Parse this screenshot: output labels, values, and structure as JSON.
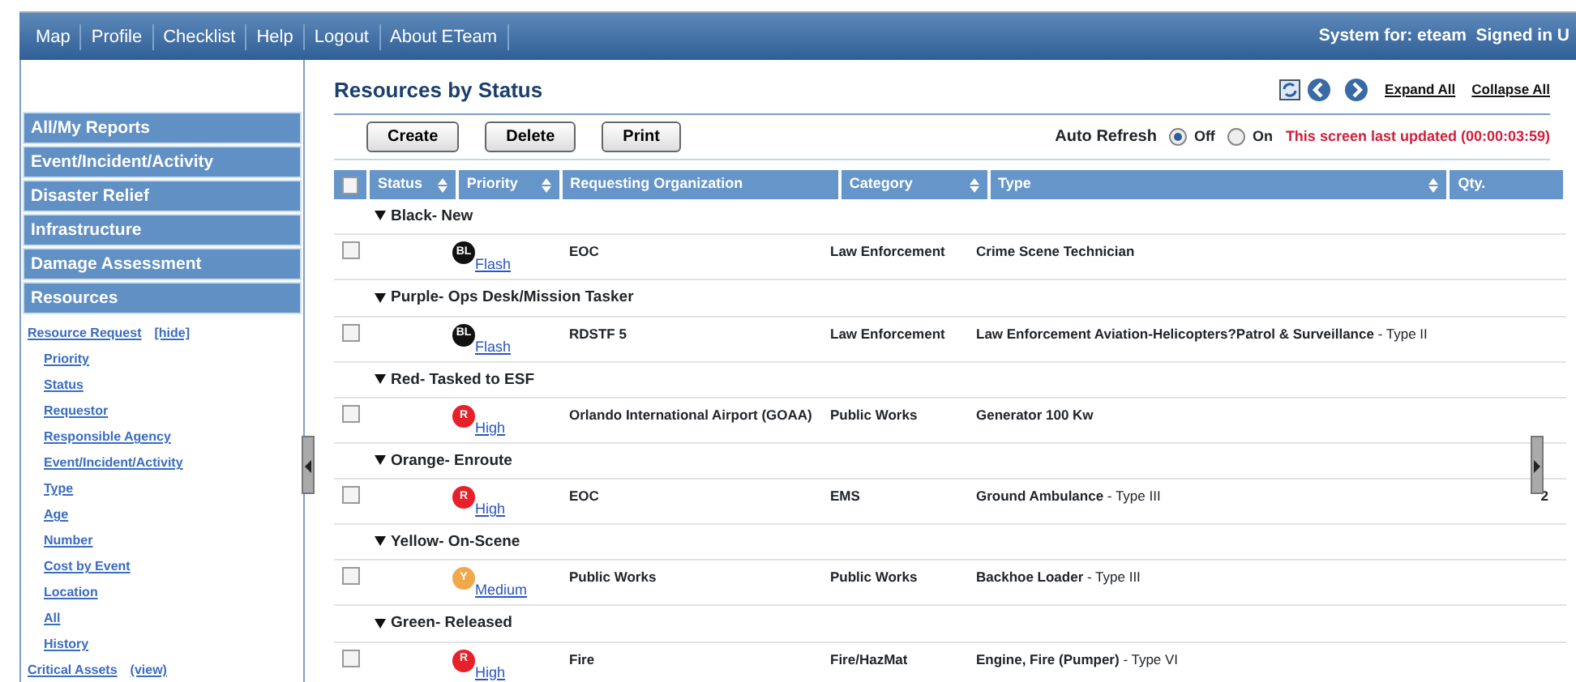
{
  "top_menu": [
    "Map",
    "Profile",
    "Checklist",
    "Help",
    "Logout",
    "About ETeam"
  ],
  "system_text": "System for: eteam  Signed in U",
  "sidebar": {
    "sections": [
      {
        "label": "All/My Reports"
      },
      {
        "label": "Event/Incident/Activity"
      },
      {
        "label": "Disaster Relief"
      },
      {
        "label": "Infrastructure"
      },
      {
        "label": "Damage Assessment"
      },
      {
        "label": "Resources"
      }
    ],
    "links": [
      {
        "label": "Resource Request",
        "action": "[hide]",
        "children": [
          {
            "label": "Priority"
          },
          {
            "label": "Status"
          },
          {
            "label": "Requestor"
          },
          {
            "label": "Responsible Agency"
          },
          {
            "label": "Event/Incident/Activity"
          },
          {
            "label": "Type"
          },
          {
            "label": "Age"
          },
          {
            "label": "Number"
          },
          {
            "label": "Cost by Event"
          },
          {
            "label": "Location"
          },
          {
            "label": "All"
          },
          {
            "label": "History"
          }
        ]
      },
      {
        "label": "Critical Assets",
        "action": "(view)"
      }
    ]
  },
  "page_title": "Resources by Status",
  "header_links": [
    "Expand All",
    "Collapse All"
  ],
  "buttons": [
    "Create",
    "Delete",
    "Print"
  ],
  "auto_refresh": {
    "label": "Auto Refresh",
    "options": [
      {
        "label": "Off",
        "selected": true
      },
      {
        "label": "On",
        "selected": false
      }
    ],
    "status": "This screen last updated (00:00:03:59)"
  },
  "table": {
    "select_all_checked": false,
    "columns": [
      {
        "label": "Status",
        "sortable": true
      },
      {
        "label": "Priority",
        "sortable": true
      },
      {
        "label": "Requesting Organization",
        "sortable": false
      },
      {
        "label": "Category",
        "sortable": true
      },
      {
        "label": "Type",
        "sortable": true
      },
      {
        "label": "Qty.",
        "sortable": false
      }
    ],
    "groups": [
      {
        "label": "Black- New",
        "rows": [
          {
            "checked": false,
            "badge": "BL",
            "color": "#111111",
            "priority": "Flash",
            "organization": "EOC",
            "category": "Law Enforcement",
            "type": "**Crime Scene Technician**",
            "qty": ""
          }
        ]
      },
      {
        "label": "Purple- Ops Desk/Mission Tasker",
        "rows": [
          {
            "checked": false,
            "badge": "BL",
            "color": "#111111",
            "priority": "Flash",
            "organization": "RDSTF 5",
            "category": "Law Enforcement",
            "type": "**Law Enforcement Aviation-Helicopters?Patrol & Surveillance** - Type II",
            "qty": ""
          }
        ]
      },
      {
        "label": "Red- Tasked to ESF",
        "rows": [
          {
            "checked": false,
            "badge": "R",
            "color": "#e8202a",
            "priority": "High",
            "organization": "Orlando International Airport (GOAA)",
            "category": "Public Works",
            "type": "**Generator 100 Kw**",
            "qty": ""
          }
        ]
      },
      {
        "label": "Orange- Enroute",
        "rows": [
          {
            "checked": false,
            "badge": "R",
            "color": "#e8202a",
            "priority": "High",
            "organization": "EOC",
            "category": "EMS",
            "type": "**Ground Ambulance** - Type III",
            "qty": "2"
          }
        ]
      },
      {
        "label": "Yellow- On-Scene",
        "rows": [
          {
            "checked": false,
            "badge": "Y",
            "color": "#f0a94a",
            "priority": "Medium",
            "organization": "Public Works",
            "category": "Public Works",
            "type": "**Backhoe Loader** - Type III",
            "qty": ""
          }
        ]
      },
      {
        "label": "Green- Released",
        "rows": [
          {
            "checked": false,
            "badge": "R",
            "color": "#e8202a",
            "priority": "High",
            "organization": "Fire",
            "category": "Fire/HazMat",
            "type": "**Engine, Fire (Pumper)** - Type VI",
            "qty": ""
          }
        ]
      }
    ]
  }
}
